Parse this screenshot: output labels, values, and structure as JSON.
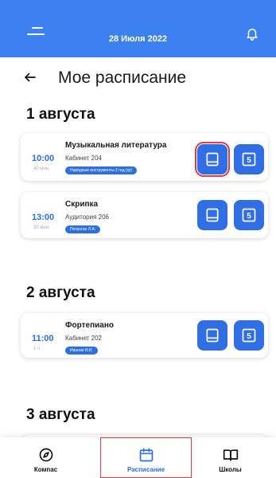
{
  "header": {
    "date": "28 Июля 2022",
    "menu_icon": "menu-icon",
    "bell_icon": "bell-icon"
  },
  "page": {
    "title": "Мое расписание",
    "back_icon": "arrow-left-icon"
  },
  "days": [
    {
      "heading": "1 августа",
      "lessons": [
        {
          "time": "10:00",
          "duration": "40 мин",
          "subject": "Музыкальная литература",
          "room": "Кабинет 204",
          "tag": "Народные инструменты 2 год (гр)"
        },
        {
          "time": "13:00",
          "duration": "30 мин",
          "subject": "Скрипка",
          "room": "Аудитория 206",
          "tag": "Петрогин Л.А."
        }
      ]
    },
    {
      "heading": "2 августа",
      "lessons": [
        {
          "time": "11:00",
          "duration": "1 ч",
          "subject": "Фортепиано",
          "room": "Кабинет 202",
          "tag": "Иванов И.И."
        }
      ]
    },
    {
      "heading": "3 августа",
      "lessons": []
    }
  ],
  "actions": {
    "book_icon": "book-icon",
    "grade_icon": "grade-5-icon",
    "grade_value": "5"
  },
  "nav": [
    {
      "label": "Компас",
      "icon": "compass-icon"
    },
    {
      "label": "Расписание",
      "icon": "calendar-icon",
      "active": true
    },
    {
      "label": "Школы",
      "icon": "open-book-icon"
    }
  ],
  "colors": {
    "primary": "#3b82f0",
    "accent": "#2d6fe0",
    "highlight": "#e53945"
  }
}
